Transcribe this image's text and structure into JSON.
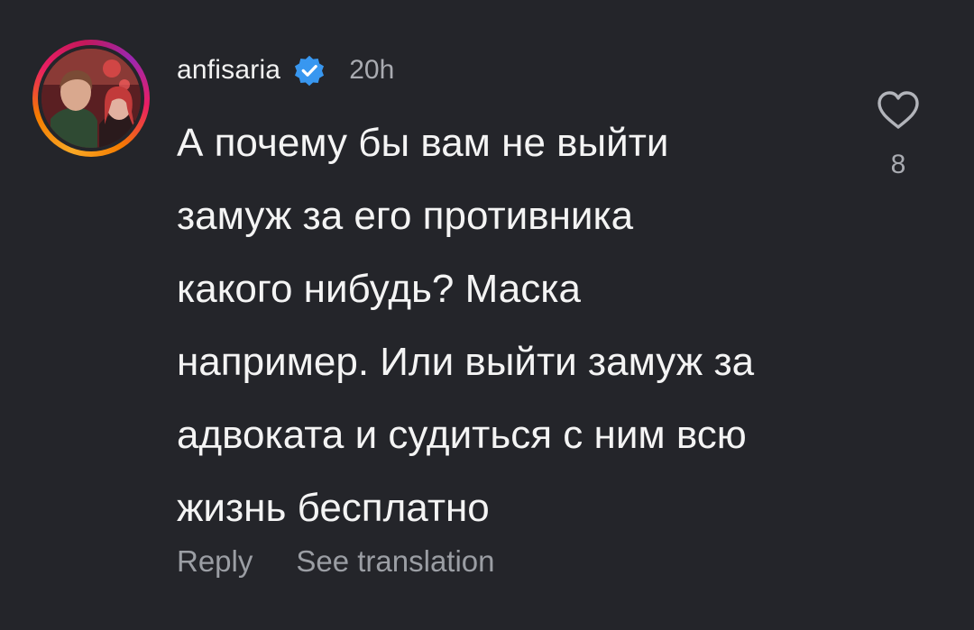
{
  "comment": {
    "username": "anfisaria",
    "timestamp": "20h",
    "text": "А почему бы вам не выйти\nзамуж за его противника\nкакого нибудь? Маска\nнапример. Или выйти замуж за\nадвоката и судиться с ним всю\nжизнь бесплатно",
    "like_count": "8",
    "verified": true,
    "actions": {
      "reply_label": "Reply",
      "translate_label": "See translation"
    }
  },
  "colors": {
    "background": "#24252a",
    "text": "#f4f4f4",
    "muted": "#a9abb1",
    "verified_badge": "#3897f0"
  },
  "icons": {
    "verified": "verified-badge-icon",
    "like": "heart-outline-icon"
  }
}
